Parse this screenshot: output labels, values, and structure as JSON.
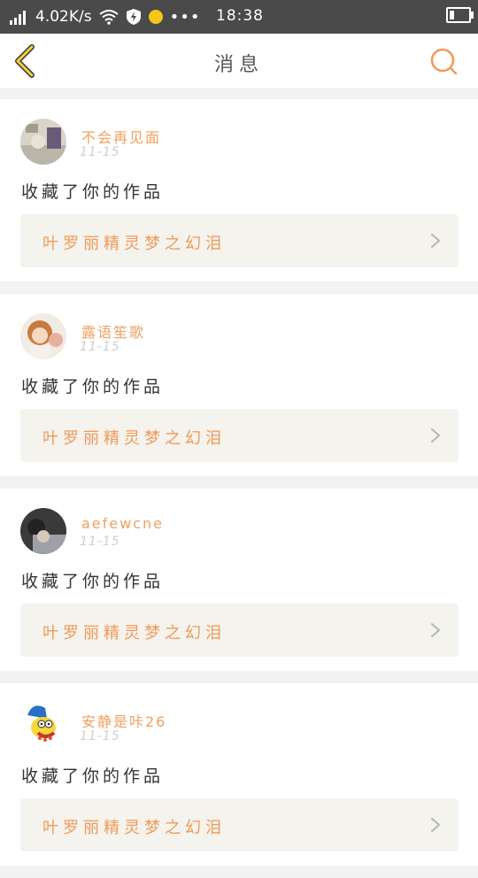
{
  "status_bar": {
    "network_speed": "4.02K/s",
    "time": "18:38"
  },
  "header": {
    "title": "消息",
    "accent_color": "#f19a58"
  },
  "messages": [
    {
      "username": "不会再见面",
      "date": "11-15",
      "action": "收藏了你的作品",
      "work_title": "叶罗丽精灵梦之幻泪",
      "avatar": "avatar-1"
    },
    {
      "username": "露语笙歌",
      "date": "11-15",
      "action": "收藏了你的作品",
      "work_title": "叶罗丽精灵梦之幻泪",
      "avatar": "avatar-2"
    },
    {
      "username": "aefewcne",
      "date": "11-15",
      "action": "收藏了你的作品",
      "work_title": "叶罗丽精灵梦之幻泪",
      "avatar": "avatar-3"
    },
    {
      "username": "安静是咔26",
      "date": "11-15",
      "action": "收藏了你的作品",
      "work_title": "叶罗丽精灵梦之幻泪",
      "avatar": "avatar-4"
    }
  ]
}
